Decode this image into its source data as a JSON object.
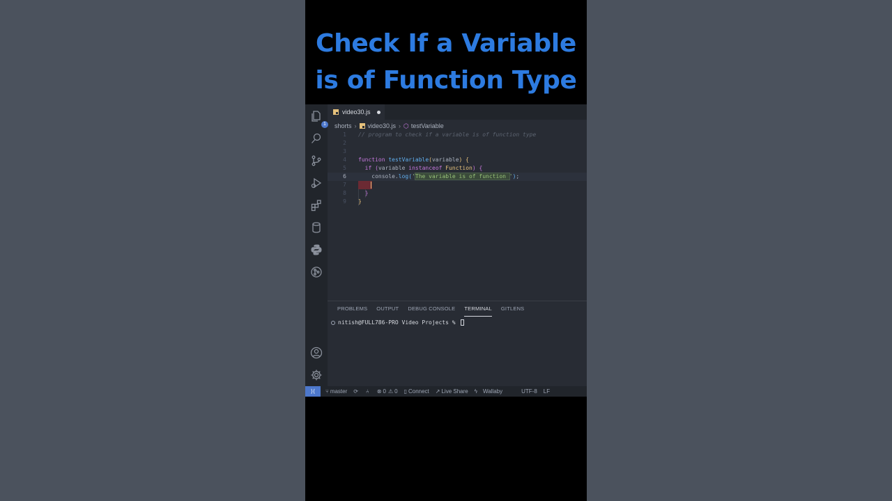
{
  "video": {
    "title_line1": "Check If a Variable",
    "title_line2": "is of Function Type"
  },
  "activity_bar": {
    "explorer_badge": "1",
    "icons": [
      "files-icon",
      "search-icon",
      "source-control-icon",
      "run-debug-icon",
      "extensions-icon",
      "database-icon",
      "python-icon",
      "gitlens-icon",
      "account-icon",
      "gear-icon"
    ]
  },
  "tab": {
    "filename": "video30.js"
  },
  "breadcrumb": {
    "folder": "shorts",
    "file": "video30.js",
    "symbol": "testVariable"
  },
  "editor": {
    "active_line": 6,
    "lines": [
      {
        "num": "1",
        "text": "// program to check if a variable is of function type"
      },
      {
        "num": "2",
        "text": ""
      },
      {
        "num": "3",
        "text": ""
      },
      {
        "num": "4",
        "text": "function testVariable(variable) {"
      },
      {
        "num": "5",
        "text": "  if (variable instanceof Function) {"
      },
      {
        "num": "6",
        "text": "    console.log('The variable is of function ');"
      },
      {
        "num": "7",
        "text": ""
      },
      {
        "num": "8",
        "text": "  }"
      },
      {
        "num": "9",
        "text": "}"
      }
    ]
  },
  "panel": {
    "tabs": [
      "PROBLEMS",
      "OUTPUT",
      "DEBUG CONSOLE",
      "TERMINAL",
      "GITLENS"
    ],
    "active_tab": "TERMINAL",
    "terminal_prompt": "nitish@FULL786-PRO Video Projects % "
  },
  "status_bar": {
    "branch": "master",
    "errors": "0",
    "warnings": "0",
    "connect": "Connect",
    "live_share": "Live Share",
    "wallaby": "Wallaby",
    "encoding": "UTF-8",
    "eol": "LF"
  },
  "colors": {
    "title_blue": "#2d7be0",
    "editor_bg": "#282c34",
    "sidebar_bg": "#21252b",
    "accent": "#4d78cc"
  }
}
